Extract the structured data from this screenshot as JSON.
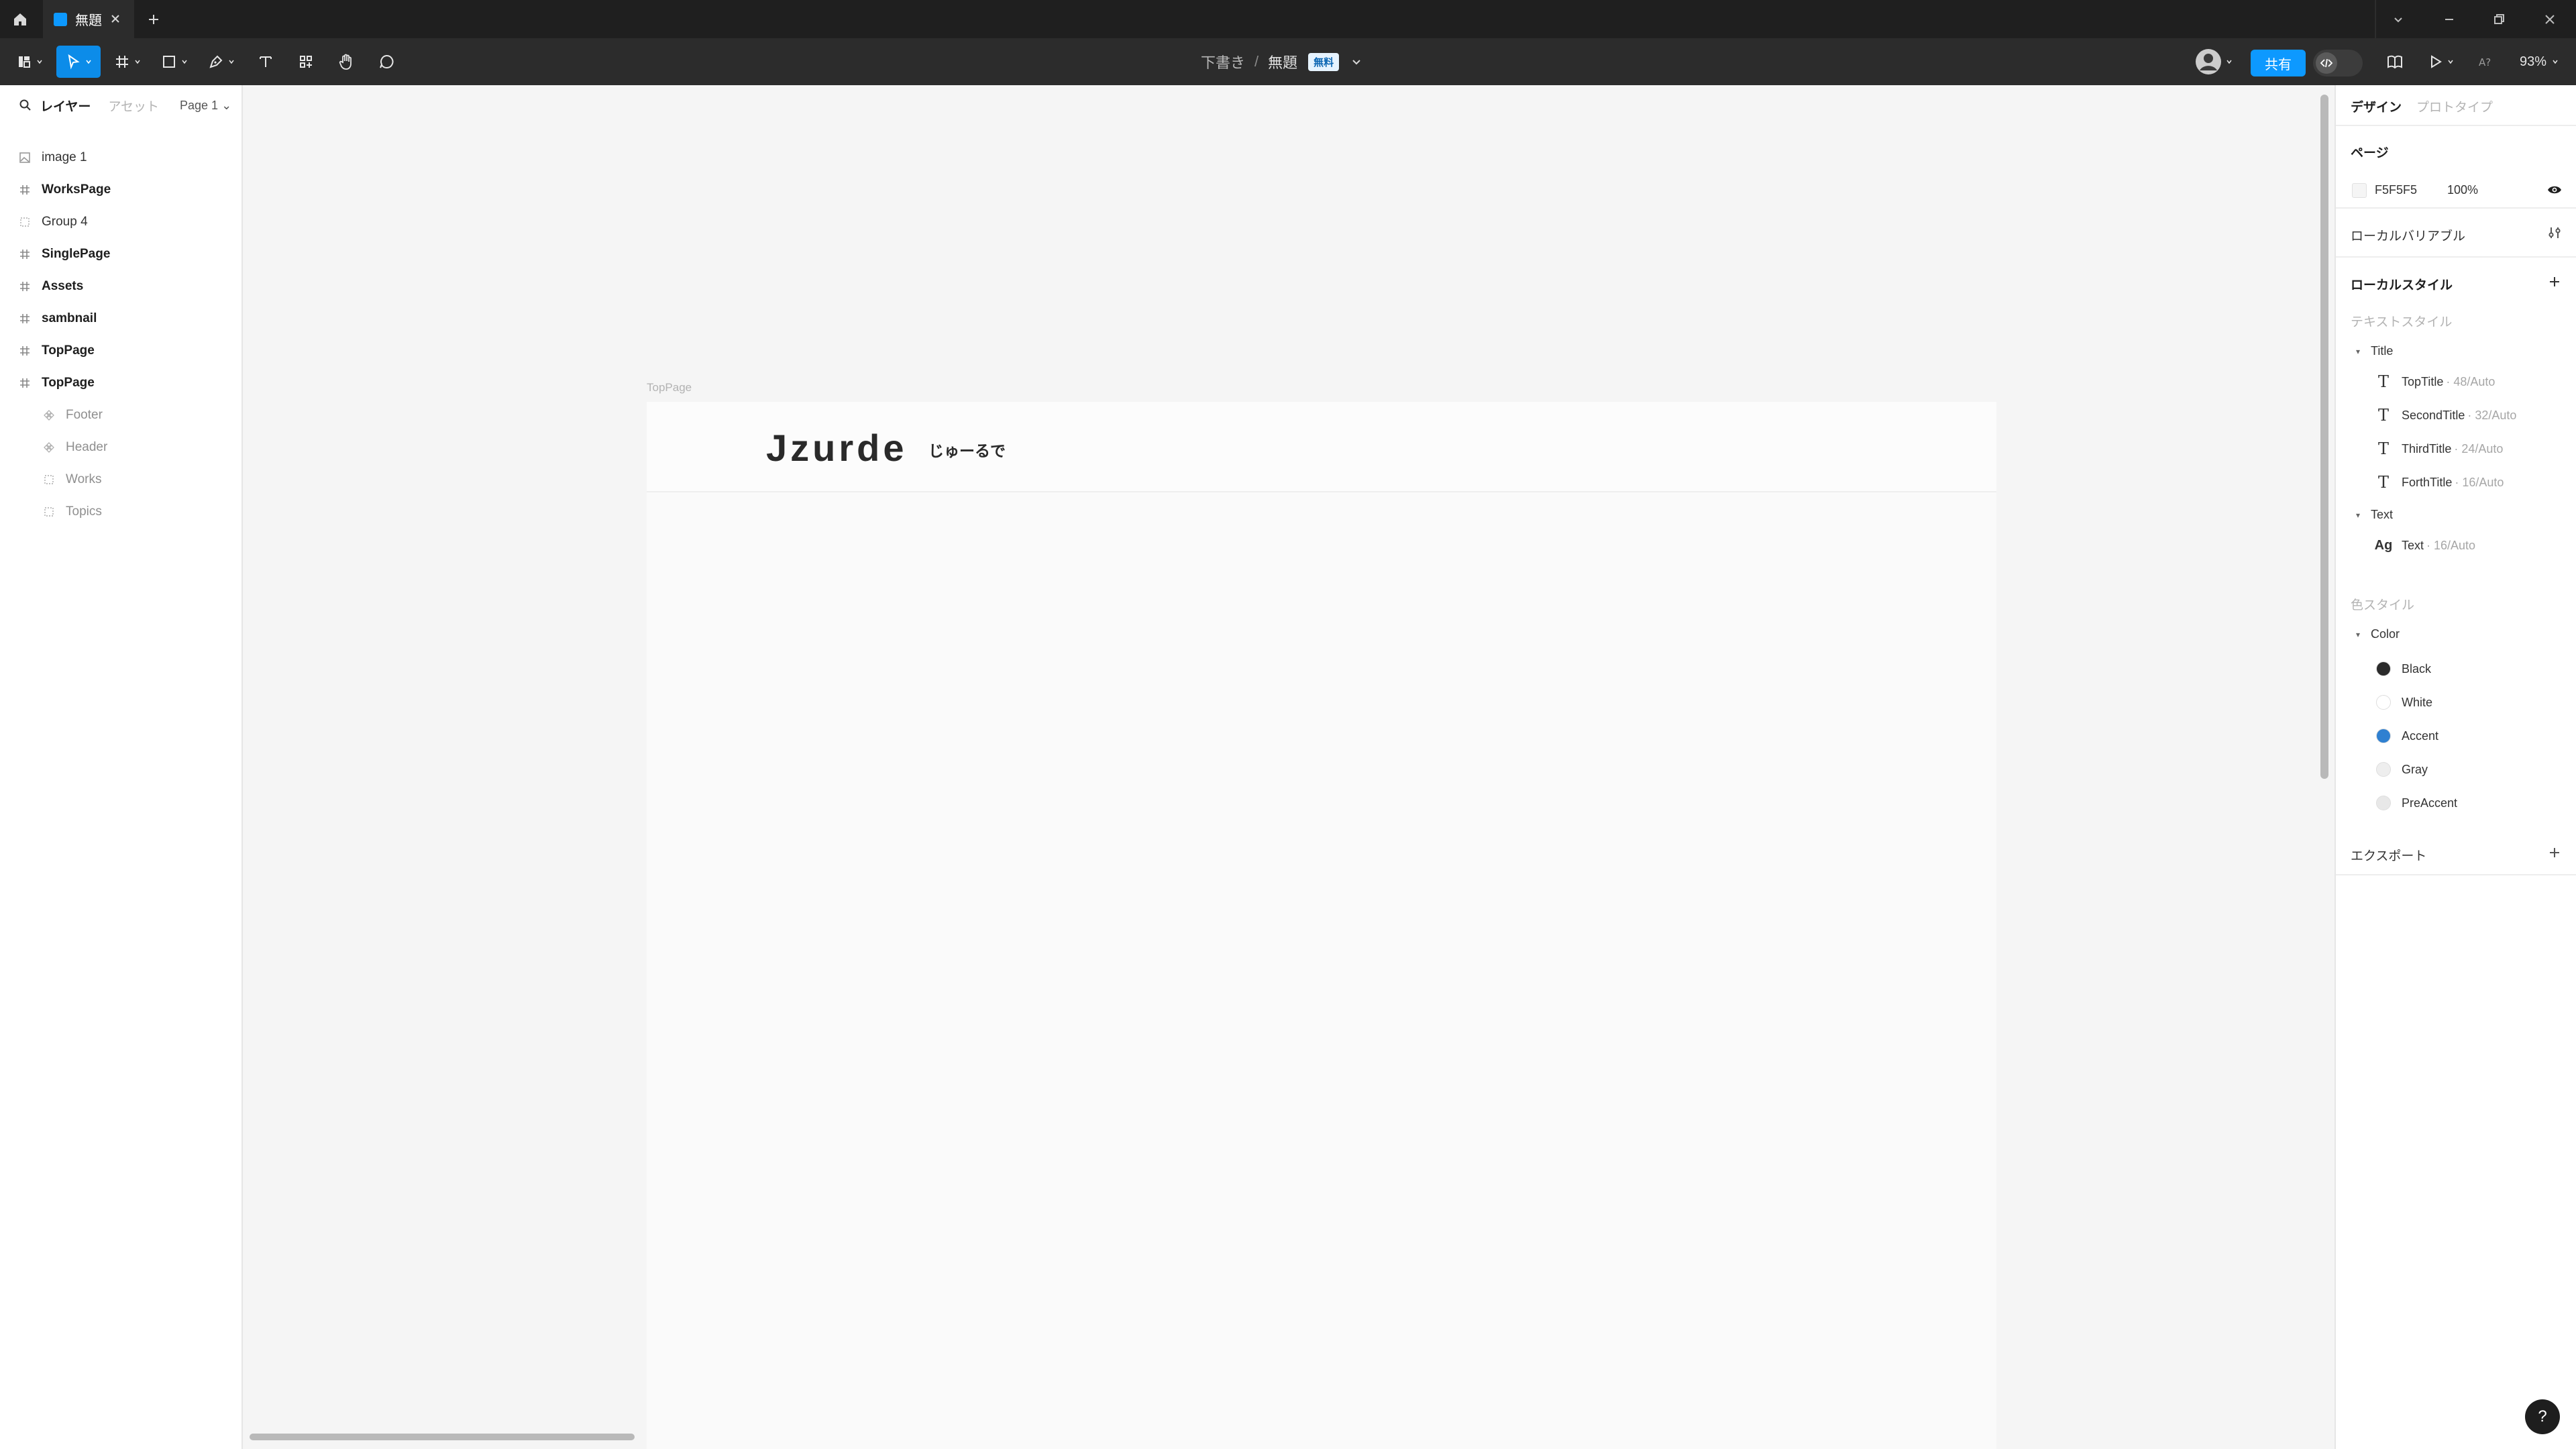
{
  "titlebar": {
    "tab_title": "無題",
    "home_icon": "home-icon",
    "controls": [
      "chevron-down-icon",
      "minimize-icon",
      "restore-icon",
      "close-icon"
    ]
  },
  "toolbar": {
    "breadcrumb_drafts": "下書き",
    "breadcrumb_sep": "/",
    "file_name": "無題",
    "plan_badge": "無料",
    "share_label": "共有",
    "zoom_label": "93%",
    "tools": [
      "main-menu-icon",
      "move-icon",
      "frame-icon",
      "shape-icon",
      "pen-icon",
      "text-icon",
      "resources-icon",
      "hand-icon",
      "comment-icon"
    ]
  },
  "leftpanel": {
    "tab_layers": "レイヤー",
    "tab_assets": "アセット",
    "page_selector": "Page 1",
    "layers": [
      {
        "name": "image 1",
        "kind": "image",
        "bold": false,
        "child": false
      },
      {
        "name": "WorksPage",
        "kind": "frame",
        "bold": true,
        "child": false
      },
      {
        "name": "Group 4",
        "kind": "group",
        "bold": false,
        "child": false
      },
      {
        "name": "SinglePage",
        "kind": "frame",
        "bold": true,
        "child": false
      },
      {
        "name": "Assets",
        "kind": "frame",
        "bold": true,
        "child": false
      },
      {
        "name": "sambnail",
        "kind": "frame",
        "bold": true,
        "child": false
      },
      {
        "name": "TopPage",
        "kind": "frame",
        "bold": true,
        "child": false
      },
      {
        "name": "TopPage",
        "kind": "frame",
        "bold": true,
        "child": false
      },
      {
        "name": "Footer",
        "kind": "component",
        "bold": false,
        "child": true
      },
      {
        "name": "Header",
        "kind": "component",
        "bold": false,
        "child": true
      },
      {
        "name": "Works",
        "kind": "group",
        "bold": false,
        "child": true
      },
      {
        "name": "Topics",
        "kind": "group",
        "bold": false,
        "child": true
      }
    ]
  },
  "canvas": {
    "frame_label": "TopPage",
    "logo_text": "Jzurde",
    "logo_subtext": "じゅーるで"
  },
  "rightpanel": {
    "tab_design": "デザイン",
    "tab_prototype": "プロトタイプ",
    "page_section": "ページ",
    "page_color": "F5F5F5",
    "page_opacity": "100%",
    "local_variables": "ローカルバリアブル",
    "local_styles": "ローカルスタイル",
    "text_styles_label": "テキストスタイル",
    "text_groups": [
      {
        "name": "Title",
        "styles": [
          {
            "name": "TopTitle",
            "meta": "· 48/Auto"
          },
          {
            "name": "SecondTitle",
            "meta": "· 32/Auto"
          },
          {
            "name": "ThirdTitle",
            "meta": "· 24/Auto"
          },
          {
            "name": "ForthTitle",
            "meta": "· 16/Auto"
          }
        ]
      },
      {
        "name": "Text",
        "styles": [
          {
            "name": "Text",
            "meta": "· 16/Auto"
          }
        ]
      }
    ],
    "text_style_icon_glyph": "T",
    "text_style_ag_glyph": "Ag",
    "color_styles_label": "色スタイル",
    "color_group": "Color",
    "colors": [
      {
        "name": "Black",
        "hex": "#2b2b2b"
      },
      {
        "name": "White",
        "hex": "#ffffff"
      },
      {
        "name": "Accent",
        "hex": "#2f80d1"
      },
      {
        "name": "Gray",
        "hex": "#eeeeee"
      },
      {
        "name": "PreAccent",
        "hex": "#e8e8e8"
      }
    ],
    "export_label": "エクスポート"
  },
  "help_label": "?"
}
